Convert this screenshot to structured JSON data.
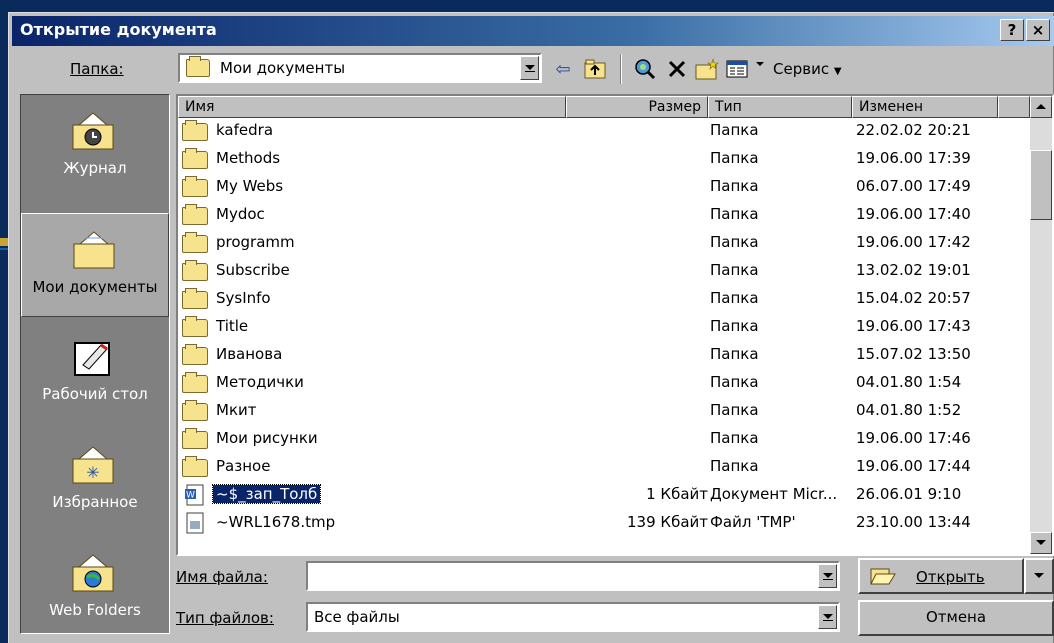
{
  "window": {
    "title": "Открытие документа",
    "help_label": "?",
    "close_label": "×"
  },
  "folder_bar": {
    "label": "Папка:",
    "current_folder": "Мои документы"
  },
  "toolbar": {
    "back_glyph": "⇦",
    "tools_label": "Сервис"
  },
  "places": [
    {
      "label": "Журнал",
      "icon": "history-icon"
    },
    {
      "label": "Мои документы",
      "icon": "my-documents-icon"
    },
    {
      "label": "Рабочий стол",
      "icon": "desktop-icon"
    },
    {
      "label": "Избранное",
      "icon": "favorites-icon"
    },
    {
      "label": "Web Folders",
      "icon": "web-folders-icon"
    }
  ],
  "columns": {
    "name": "Имя",
    "size": "Размер",
    "type": "Тип",
    "modified": "Изменен"
  },
  "files": [
    {
      "name": "kafedra",
      "size": "",
      "type": "Папка",
      "modified": "22.02.02 20:21",
      "icon": "folder"
    },
    {
      "name": "Methods",
      "size": "",
      "type": "Папка",
      "modified": "19.06.00 17:39",
      "icon": "folder"
    },
    {
      "name": "My Webs",
      "size": "",
      "type": "Папка",
      "modified": "06.07.00 17:49",
      "icon": "folder"
    },
    {
      "name": "Mydoc",
      "size": "",
      "type": "Папка",
      "modified": "19.06.00 17:40",
      "icon": "folder"
    },
    {
      "name": "programm",
      "size": "",
      "type": "Папка",
      "modified": "19.06.00 17:42",
      "icon": "folder"
    },
    {
      "name": "Subscribe",
      "size": "",
      "type": "Папка",
      "modified": "13.02.02 19:01",
      "icon": "folder"
    },
    {
      "name": "SysInfo",
      "size": "",
      "type": "Папка",
      "modified": "15.04.02 20:57",
      "icon": "folder"
    },
    {
      "name": "Title",
      "size": "",
      "type": "Папка",
      "modified": "19.06.00 17:43",
      "icon": "folder"
    },
    {
      "name": "Иванова",
      "size": "",
      "type": "Папка",
      "modified": "15.07.02 13:50",
      "icon": "folder"
    },
    {
      "name": "Методички",
      "size": "",
      "type": "Папка",
      "modified": "04.01.80 1:54",
      "icon": "folder"
    },
    {
      "name": "Мкит",
      "size": "",
      "type": "Папка",
      "modified": "04.01.80 1:52",
      "icon": "folder"
    },
    {
      "name": "Мои рисунки",
      "size": "",
      "type": "Папка",
      "modified": "19.06.00 17:46",
      "icon": "folder"
    },
    {
      "name": "Разное",
      "size": "",
      "type": "Папка",
      "modified": "19.06.00 17:44",
      "icon": "folder"
    },
    {
      "name": "~$_зап_Толб",
      "size": "1 Кбайт",
      "type": "Документ Micr...",
      "modified": "26.06.01 9:10",
      "icon": "word-doc",
      "selected": true
    },
    {
      "name": "~WRL1678.tmp",
      "size": "139 Кбайт",
      "type": "Файл 'TMP'",
      "modified": "23.10.00 13:44",
      "icon": "tmp-file"
    }
  ],
  "file_name": {
    "label": "Имя файла:",
    "value": ""
  },
  "file_type": {
    "label": "Тип файлов:",
    "value": "Все файлы"
  },
  "buttons": {
    "open": "Открыть",
    "cancel": "Отмена"
  },
  "colors": {
    "selection": "#0a246a",
    "dialog": "#c0c0c0",
    "places_bar": "#808080"
  }
}
